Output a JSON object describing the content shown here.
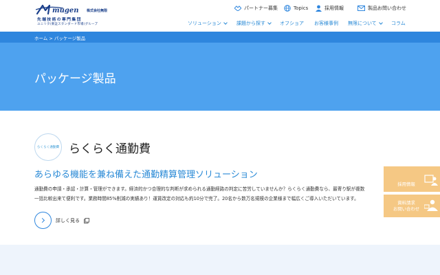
{
  "header": {
    "logo": {
      "wordmark": "mugen",
      "corp_name": "株式会社無限",
      "tagline1": "先端技術の専門集団",
      "tagline2": "ユニリタ(東証スタンダード市場)グループ"
    },
    "utility_nav": [
      {
        "label": "パートナー募集",
        "icon": "handshake-icon"
      },
      {
        "label": "Topics",
        "icon": "globe-icon"
      },
      {
        "label": "採用情報",
        "icon": "person-icon"
      },
      {
        "label": "製品お問い合わせ",
        "icon": "mail-icon"
      }
    ],
    "global_nav": [
      {
        "label": "ソリューション",
        "dropdown": true
      },
      {
        "label": "課題から探す",
        "dropdown": true
      },
      {
        "label": "オフショア",
        "dropdown": false
      },
      {
        "label": "お客様事例",
        "dropdown": false
      },
      {
        "label": "無限について",
        "dropdown": true
      },
      {
        "label": "コラム",
        "dropdown": false
      }
    ]
  },
  "breadcrumb": {
    "home": "ホーム",
    "separator": ">",
    "current": "パッケージ製品"
  },
  "hero": {
    "title": "パッケージ製品"
  },
  "product": {
    "badge_text": "らくらく通勤費",
    "name": "らくらく通勤費",
    "catch": "あらゆる機能を兼ね備えた通勤精算管理ソリューション",
    "description_lines": [
      "通勤費の申請・承認・計算・管理ができます。経済的かつ合理的な判断が求められる通勤経路の判定に苦労していませんか？らくらく通勤費なら、最寄り駅が複数",
      "一括比較出来て便利です。業務時間85%削減の実績あり！運賃改定の対応も約10分で完了。20名から数万名規模の企業様まで幅広くご導入いただいています。"
    ],
    "more_label": "詳しく見る"
  },
  "side_tabs": {
    "recruit": "採用情報",
    "contact_line1": "資料請求",
    "contact_line2": "お問い合わせ"
  },
  "colors": {
    "brand_blue": "#2e86de",
    "hero_blue": "#4ea2ef",
    "link_blue": "#2a8ad6",
    "side_tab_orange": "#f5c884",
    "logo_navy": "#1a3f8a"
  }
}
